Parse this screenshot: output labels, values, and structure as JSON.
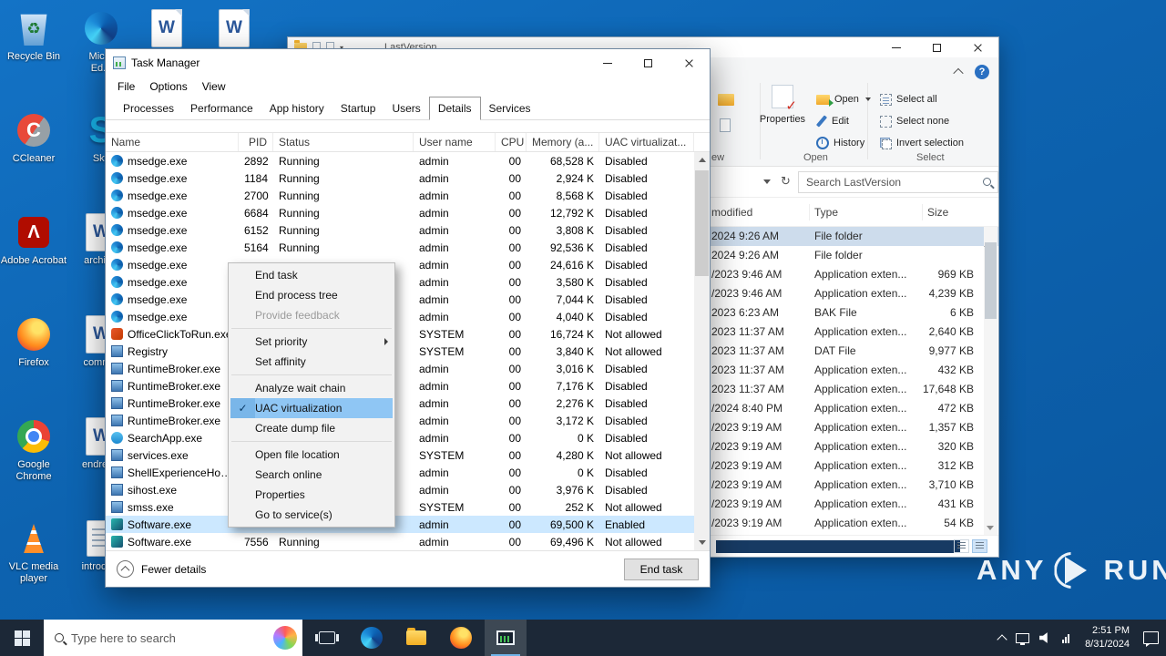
{
  "desktop": {
    "columns": [
      [
        {
          "id": "recycle-bin",
          "icon": "recycle-bin",
          "label": "Recycle Bin"
        },
        {
          "id": "ccleaner",
          "icon": "ccleaner",
          "label": "CCleaner"
        },
        {
          "id": "adobe-acrobat",
          "icon": "adobe",
          "label": "Adobe Acrobat"
        },
        {
          "id": "firefox",
          "icon": "firefox",
          "label": "Firefox"
        },
        {
          "id": "google-chrome",
          "icon": "chrome",
          "label": "Google Chrome"
        },
        {
          "id": "vlc-media-player",
          "icon": "vlc",
          "label": "VLC media player"
        }
      ],
      [
        {
          "id": "microsoft-edge",
          "icon": "edge",
          "label": "Micro\nEd..."
        },
        {
          "id": "skype",
          "icon": "skype",
          "label": "Sky"
        },
        {
          "id": "archive-document",
          "icon": "word",
          "label": "archiv..."
        },
        {
          "id": "comm-document",
          "icon": "word",
          "label": "comm..."
        },
        {
          "id": "endrev-document",
          "icon": "word",
          "label": "endrev..."
        },
        {
          "id": "introdu-document",
          "icon": "page",
          "label": "introdu..."
        }
      ]
    ],
    "top_documents": [
      {
        "id": "word-doc-1",
        "icon": "word",
        "label": ""
      },
      {
        "id": "word-doc-2",
        "icon": "word",
        "label": ""
      }
    ]
  },
  "explorer": {
    "title": "LastVersion",
    "search_placeholder": "Search LastVersion",
    "ribbon": {
      "new_group_partial": "ew",
      "properties": "Properties",
      "open_button": "Open",
      "edit": "Edit",
      "history": "History",
      "select_all": "Select all",
      "select_none": "Select none",
      "invert_selection": "Invert selection",
      "group_open": "Open",
      "group_select": "Select"
    },
    "columns": {
      "modified": "modified",
      "type": "Type",
      "size": "Size"
    },
    "rows": [
      {
        "modified": "2024 9:26 AM",
        "type": "File folder",
        "size": "",
        "selected": true
      },
      {
        "modified": "2024 9:26 AM",
        "type": "File folder",
        "size": ""
      },
      {
        "modified": "/2023 9:46 AM",
        "type": "Application exten...",
        "size": "969 KB"
      },
      {
        "modified": "/2023 9:46 AM",
        "type": "Application exten...",
        "size": "4,239 KB"
      },
      {
        "modified": "2023 6:23 AM",
        "type": "BAK File",
        "size": "6 KB"
      },
      {
        "modified": "2023 11:37 AM",
        "type": "Application exten...",
        "size": "2,640 KB"
      },
      {
        "modified": "2023 11:37 AM",
        "type": "DAT File",
        "size": "9,977 KB"
      },
      {
        "modified": "2023 11:37 AM",
        "type": "Application exten...",
        "size": "432 KB"
      },
      {
        "modified": "2023 11:37 AM",
        "type": "Application exten...",
        "size": "17,648 KB"
      },
      {
        "modified": "/2024 8:40 PM",
        "type": "Application exten...",
        "size": "472 KB"
      },
      {
        "modified": "/2023 9:19 AM",
        "type": "Application exten...",
        "size": "1,357 KB"
      },
      {
        "modified": "/2023 9:19 AM",
        "type": "Application exten...",
        "size": "320 KB"
      },
      {
        "modified": "/2023 9:19 AM",
        "type": "Application exten...",
        "size": "312 KB"
      },
      {
        "modified": "/2023 9:19 AM",
        "type": "Application exten...",
        "size": "3,710 KB"
      },
      {
        "modified": "/2023 9:19 AM",
        "type": "Application exten...",
        "size": "431 KB"
      },
      {
        "modified": "/2023 9:19 AM",
        "type": "Application exten...",
        "size": "54 KB"
      }
    ]
  },
  "task_manager": {
    "title": "Task Manager",
    "menu": [
      "File",
      "Options",
      "View"
    ],
    "tabs": [
      {
        "label": "Processes"
      },
      {
        "label": "Performance"
      },
      {
        "label": "App history"
      },
      {
        "label": "Startup"
      },
      {
        "label": "Users"
      },
      {
        "label": "Details",
        "active": true
      },
      {
        "label": "Services"
      }
    ],
    "columns": [
      "Name",
      "PID",
      "Status",
      "User name",
      "CPU",
      "Memory (a...",
      "UAC virtualizat..."
    ],
    "rows": [
      {
        "icon": "edge",
        "name": "msedge.exe",
        "pid": "2892",
        "status": "Running",
        "user": "admin",
        "cpu": "00",
        "memory": "68,528 K",
        "uac": "Disabled"
      },
      {
        "icon": "edge",
        "name": "msedge.exe",
        "pid": "1184",
        "status": "Running",
        "user": "admin",
        "cpu": "00",
        "memory": "2,924 K",
        "uac": "Disabled"
      },
      {
        "icon": "edge",
        "name": "msedge.exe",
        "pid": "2700",
        "status": "Running",
        "user": "admin",
        "cpu": "00",
        "memory": "8,568 K",
        "uac": "Disabled"
      },
      {
        "icon": "edge",
        "name": "msedge.exe",
        "pid": "6684",
        "status": "Running",
        "user": "admin",
        "cpu": "00",
        "memory": "12,792 K",
        "uac": "Disabled"
      },
      {
        "icon": "edge",
        "name": "msedge.exe",
        "pid": "6152",
        "status": "Running",
        "user": "admin",
        "cpu": "00",
        "memory": "3,808 K",
        "uac": "Disabled"
      },
      {
        "icon": "edge",
        "name": "msedge.exe",
        "pid": "5164",
        "status": "Running",
        "user": "admin",
        "cpu": "00",
        "memory": "92,536 K",
        "uac": "Disabled"
      },
      {
        "icon": "edge",
        "name": "msedge.exe",
        "pid": "",
        "status": "",
        "user": "admin",
        "cpu": "00",
        "memory": "24,616 K",
        "uac": "Disabled"
      },
      {
        "icon": "edge",
        "name": "msedge.exe",
        "pid": "",
        "status": "",
        "user": "admin",
        "cpu": "00",
        "memory": "3,580 K",
        "uac": "Disabled"
      },
      {
        "icon": "edge",
        "name": "msedge.exe",
        "pid": "",
        "status": "",
        "user": "admin",
        "cpu": "00",
        "memory": "7,044 K",
        "uac": "Disabled"
      },
      {
        "icon": "edge",
        "name": "msedge.exe",
        "pid": "",
        "status": "",
        "user": "admin",
        "cpu": "00",
        "memory": "4,040 K",
        "uac": "Disabled"
      },
      {
        "icon": "office",
        "name": "OfficeClickToRun.exe",
        "pid": "",
        "status": "",
        "user": "SYSTEM",
        "cpu": "00",
        "memory": "16,724 K",
        "uac": "Not allowed"
      },
      {
        "icon": "win",
        "name": "Registry",
        "pid": "",
        "status": "",
        "user": "SYSTEM",
        "cpu": "00",
        "memory": "3,840 K",
        "uac": "Not allowed"
      },
      {
        "icon": "win",
        "name": "RuntimeBroker.exe",
        "pid": "",
        "status": "",
        "user": "admin",
        "cpu": "00",
        "memory": "3,016 K",
        "uac": "Disabled"
      },
      {
        "icon": "win",
        "name": "RuntimeBroker.exe",
        "pid": "",
        "status": "",
        "user": "admin",
        "cpu": "00",
        "memory": "7,176 K",
        "uac": "Disabled"
      },
      {
        "icon": "win",
        "name": "RuntimeBroker.exe",
        "pid": "",
        "status": "",
        "user": "admin",
        "cpu": "00",
        "memory": "2,276 K",
        "uac": "Disabled"
      },
      {
        "icon": "win",
        "name": "RuntimeBroker.exe",
        "pid": "",
        "status": "",
        "user": "admin",
        "cpu": "00",
        "memory": "3,172 K",
        "uac": "Disabled"
      },
      {
        "icon": "search",
        "name": "SearchApp.exe",
        "pid": "",
        "status": "",
        "user": "admin",
        "cpu": "00",
        "memory": "0 K",
        "uac": "Disabled"
      },
      {
        "icon": "win",
        "name": "services.exe",
        "pid": "",
        "status": "",
        "user": "SYSTEM",
        "cpu": "00",
        "memory": "4,280 K",
        "uac": "Not allowed"
      },
      {
        "icon": "win",
        "name": "ShellExperienceHost.exe",
        "pid": "",
        "status": "",
        "user": "admin",
        "cpu": "00",
        "memory": "0 K",
        "uac": "Disabled"
      },
      {
        "icon": "win",
        "name": "sihost.exe",
        "pid": "",
        "status": "",
        "user": "admin",
        "cpu": "00",
        "memory": "3,976 K",
        "uac": "Disabled"
      },
      {
        "icon": "win",
        "name": "smss.exe",
        "pid": "",
        "status": "",
        "user": "SYSTEM",
        "cpu": "00",
        "memory": "252 K",
        "uac": "Not allowed"
      },
      {
        "icon": "soft",
        "name": "Software.exe",
        "pid": "",
        "status": "",
        "user": "admin",
        "cpu": "00",
        "memory": "69,500 K",
        "uac": "Enabled",
        "selected": true
      },
      {
        "icon": "soft",
        "name": "Software.exe",
        "pid": "7556",
        "status": "Running",
        "user": "admin",
        "cpu": "00",
        "memory": "69,496 K",
        "uac": "Not allowed"
      }
    ],
    "footer": {
      "fewer_details": "Fewer details",
      "end_task": "End task"
    }
  },
  "context_menu": {
    "items": [
      {
        "label": "End task"
      },
      {
        "label": "End process tree"
      },
      {
        "label": "Provide feedback",
        "disabled": true
      },
      {
        "separator": true
      },
      {
        "label": "Set priority",
        "submenu": true
      },
      {
        "label": "Set affinity"
      },
      {
        "separator": true
      },
      {
        "label": "Analyze wait chain"
      },
      {
        "label": "UAC virtualization",
        "checked": true,
        "highlighted": true
      },
      {
        "label": "Create dump file"
      },
      {
        "separator": true
      },
      {
        "label": "Open file location"
      },
      {
        "label": "Search online"
      },
      {
        "label": "Properties"
      },
      {
        "label": "Go to service(s)"
      }
    ]
  },
  "taskbar": {
    "search_placeholder": "Type here to search",
    "clock": {
      "time": "2:51 PM",
      "date": "8/31/2024"
    },
    "buttons": [
      {
        "id": "task-view"
      },
      {
        "id": "edge"
      },
      {
        "id": "file-explorer"
      },
      {
        "id": "firefox"
      },
      {
        "id": "task-manager",
        "active": true
      }
    ]
  },
  "watermark": {
    "left": "ANY",
    "right": "RUN"
  },
  "colors": {
    "desktop_blue": "#0d63b0",
    "selection_blue": "#cce8ff",
    "menu_highlight": "#8fc6f4",
    "taskbar_dark": "#1c2837"
  }
}
